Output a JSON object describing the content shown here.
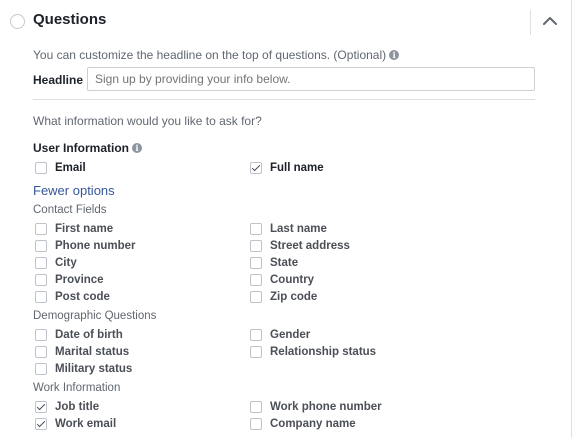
{
  "header": {
    "title": "Questions"
  },
  "headline_hint": "You can customize the headline on the top of questions. (Optional)",
  "headline": {
    "label": "Headline",
    "placeholder": "Sign up by providing your info below."
  },
  "question": "What information would you like to ask for?",
  "user_information": {
    "title": "User Information",
    "email": {
      "label": "Email",
      "checked": false
    },
    "full_name": {
      "label": "Full name",
      "checked": true
    }
  },
  "fewer_options": "Fewer options",
  "contact_fields": {
    "title": "Contact Fields",
    "first_name": {
      "label": "First name",
      "checked": false
    },
    "last_name": {
      "label": "Last name",
      "checked": false
    },
    "phone_number": {
      "label": "Phone number",
      "checked": false
    },
    "street_address": {
      "label": "Street address",
      "checked": false
    },
    "city": {
      "label": "City",
      "checked": false
    },
    "state": {
      "label": "State",
      "checked": false
    },
    "province": {
      "label": "Province",
      "checked": false
    },
    "country": {
      "label": "Country",
      "checked": false
    },
    "post_code": {
      "label": "Post code",
      "checked": false
    },
    "zip_code": {
      "label": "Zip code",
      "checked": false
    }
  },
  "demographic_questions": {
    "title": "Demographic Questions",
    "date_of_birth": {
      "label": "Date of birth",
      "checked": false
    },
    "gender": {
      "label": "Gender",
      "checked": false
    },
    "marital_status": {
      "label": "Marital status",
      "checked": false
    },
    "relationship_status": {
      "label": "Relationship status",
      "checked": false
    },
    "military_status": {
      "label": "Military status",
      "checked": false
    }
  },
  "work_information": {
    "title": "Work Information",
    "job_title": {
      "label": "Job title",
      "checked": true
    },
    "work_phone_number": {
      "label": "Work phone number",
      "checked": false
    },
    "work_email": {
      "label": "Work email",
      "checked": true
    },
    "company_name": {
      "label": "Company name",
      "checked": false
    }
  }
}
